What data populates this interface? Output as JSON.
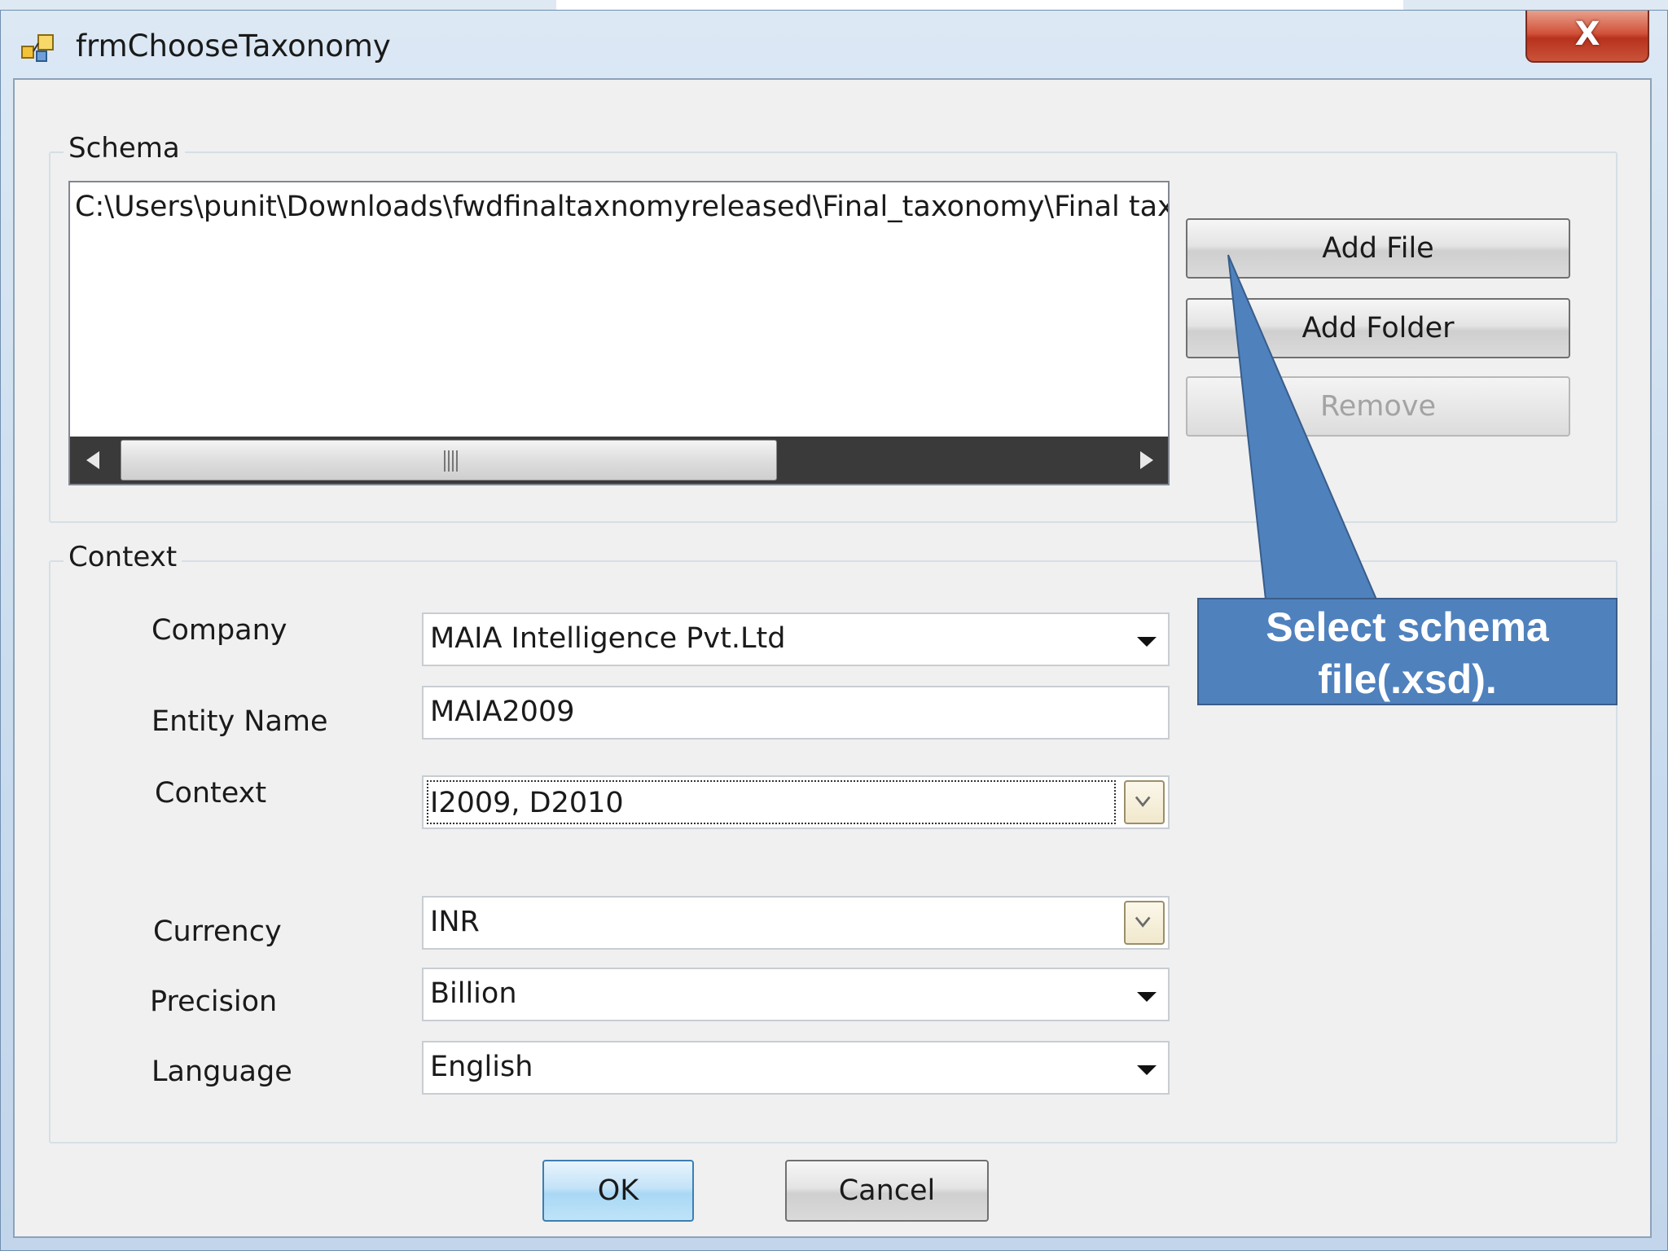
{
  "window": {
    "title": "frmChooseTaxonomy",
    "close_label": "X"
  },
  "schema": {
    "legend": "Schema",
    "items": [
      "C:\\Users\\punit\\Downloads\\fwdfinaltaxnomyreleased\\Final_taxonomy\\Final taxonom"
    ],
    "scroll_grip": "||||",
    "buttons": {
      "add_file": "Add File",
      "add_folder": "Add Folder",
      "remove": "Remove"
    }
  },
  "context": {
    "legend": "Context",
    "company": {
      "label": "Company",
      "value": "MAIA Intelligence Pvt.Ltd"
    },
    "entity_name": {
      "label": "Entity Name",
      "value": "MAIA2009"
    },
    "context": {
      "label": "Context",
      "value": "I2009, D2010"
    },
    "currency": {
      "label": "Currency",
      "value": "INR"
    },
    "precision": {
      "label": "Precision",
      "value": "Billion"
    },
    "language": {
      "label": "Language",
      "value": "English"
    }
  },
  "footer": {
    "ok": "OK",
    "cancel": "Cancel"
  },
  "callout": {
    "text_line1": "Select schema",
    "text_line2": "file(.xsd).",
    "color": "#4f81bd"
  }
}
